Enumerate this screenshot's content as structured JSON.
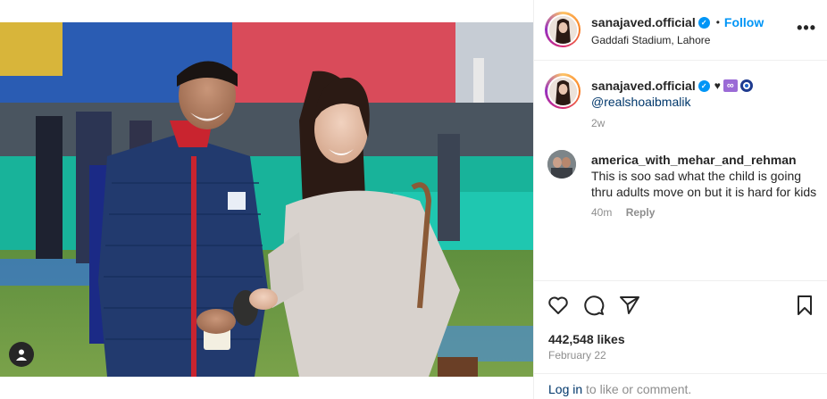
{
  "post": {
    "username": "sanajaved.official",
    "follow_label": "Follow",
    "location": "Gaddafi Stadium, Lahore",
    "more_label": "•••"
  },
  "caption": {
    "username": "sanajaved.official",
    "emoji_heart": "♥",
    "emoji_infinity": "∞",
    "mention": "@realshoaibmalik",
    "time": "2w"
  },
  "comment": {
    "username": "america_with_mehar_and_rehman",
    "text": "This is soo sad what the child is going thru adults move on but it is hard for kids",
    "time": "40m",
    "reply_label": "Reply"
  },
  "stats": {
    "likes": "442,548 likes",
    "date": "February 22"
  },
  "footer": {
    "login_link": "Log in",
    "login_rest": " to like or comment."
  },
  "icons": {
    "verified": "verified-badge-icon",
    "like": "heart-icon",
    "comment": "comment-bubble-icon",
    "share": "paper-plane-icon",
    "save": "bookmark-icon",
    "tag": "user-tag-icon"
  },
  "colors": {
    "accent": "#0095f6",
    "link": "#00376b",
    "muted": "#8e8e8e"
  }
}
